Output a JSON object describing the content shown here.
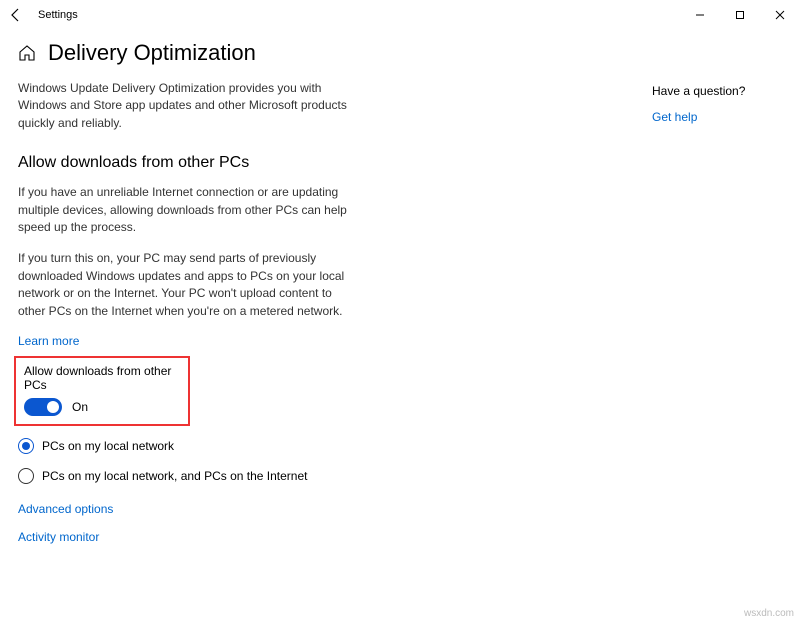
{
  "titlebar": {
    "app_name": "Settings"
  },
  "header": {
    "page_title": "Delivery Optimization"
  },
  "main": {
    "intro": "Windows Update Delivery Optimization provides you with Windows and Store app updates and other Microsoft products quickly and reliably.",
    "section_heading": "Allow downloads from other PCs",
    "para1": "If you have an unreliable Internet connection or are updating multiple devices, allowing downloads from other PCs can help speed up the process.",
    "para2": "If you turn this on, your PC may send parts of previously downloaded Windows updates and apps to PCs on your local network or on the Internet. Your PC won't upload content to other PCs on the Internet when you're on a metered network.",
    "learn_more": "Learn more",
    "toggle_label": "Allow downloads from other PCs",
    "toggle_state": "On",
    "radio1": "PCs on my local network",
    "radio2": "PCs on my local network, and PCs on the Internet",
    "advanced_link": "Advanced options",
    "activity_link": "Activity monitor"
  },
  "side": {
    "question": "Have a question?",
    "get_help": "Get help"
  },
  "watermark": "wsxdn.com"
}
